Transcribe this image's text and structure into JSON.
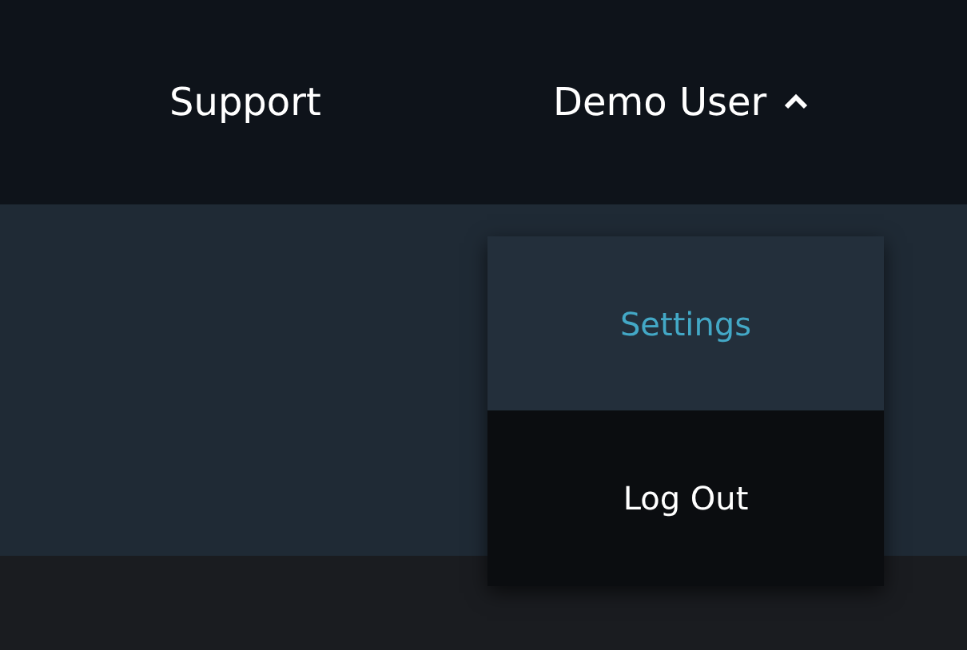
{
  "nav": {
    "links": [
      {
        "label": "Support"
      }
    ],
    "user": {
      "label": "Demo User",
      "expanded": true
    }
  },
  "menu": {
    "items": [
      {
        "label": "Settings",
        "selected": true
      },
      {
        "label": "Log Out",
        "selected": false
      }
    ]
  }
}
